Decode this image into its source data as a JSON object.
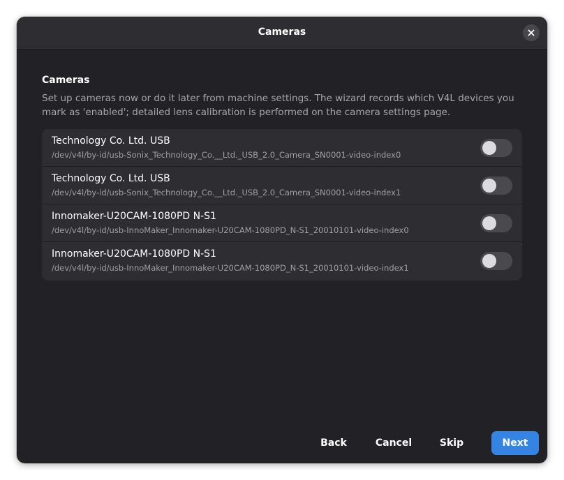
{
  "window": {
    "title": "Cameras",
    "close_icon": "close-icon"
  },
  "section": {
    "title": "Cameras",
    "description": "Set up cameras now or do it later from machine settings. The wizard records which V4L devices you mark as 'enabled'; detailed lens calibration is performed on the camera settings page."
  },
  "cameras": [
    {
      "name": "Technology Co.  Ltd. USB",
      "path": "/dev/v4l/by-id/usb-Sonix_Technology_Co.__Ltd._USB_2.0_Camera_SN0001-video-index0",
      "enabled": false
    },
    {
      "name": "Technology Co.  Ltd. USB",
      "path": "/dev/v4l/by-id/usb-Sonix_Technology_Co.__Ltd._USB_2.0_Camera_SN0001-video-index1",
      "enabled": false
    },
    {
      "name": "Innomaker-U20CAM-1080PD N-S1",
      "path": "/dev/v4l/by-id/usb-InnoMaker_Innomaker-U20CAM-1080PD_N-S1_20010101-video-index0",
      "enabled": false
    },
    {
      "name": "Innomaker-U20CAM-1080PD N-S1",
      "path": "/dev/v4l/by-id/usb-InnoMaker_Innomaker-U20CAM-1080PD_N-S1_20010101-video-index1",
      "enabled": false
    }
  ],
  "footer": {
    "back_label": "Back",
    "cancel_label": "Cancel",
    "skip_label": "Skip",
    "next_label": "Next"
  },
  "colors": {
    "accent": "#3584e4",
    "dialog_bg": "#222226",
    "row_bg": "#2e2e32"
  }
}
